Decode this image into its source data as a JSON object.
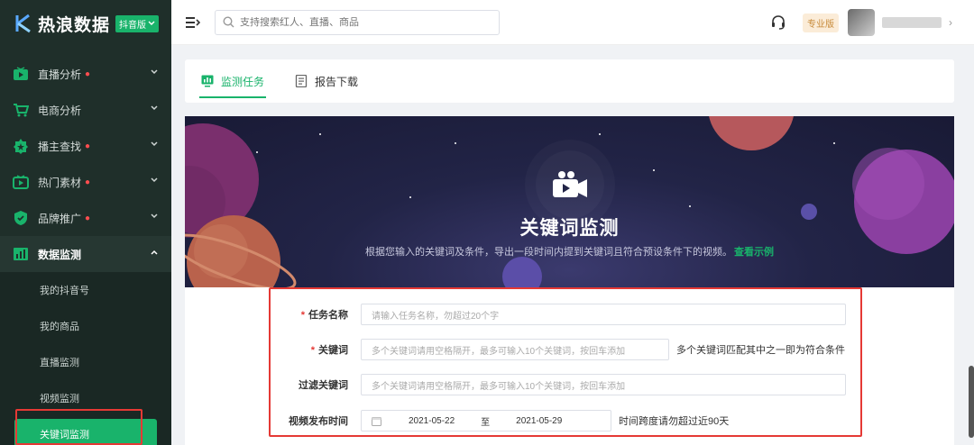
{
  "app": {
    "logo_text": "热浪数据",
    "edition": "抖音版"
  },
  "sidebar": {
    "items": [
      {
        "label": "直播分析",
        "dot": "●"
      },
      {
        "label": "电商分析",
        "dot": ""
      },
      {
        "label": "播主查找",
        "dot": "●"
      },
      {
        "label": "热门素材",
        "dot": "●"
      },
      {
        "label": "品牌推广",
        "dot": "●"
      },
      {
        "label": "数据监测",
        "dot": ""
      }
    ],
    "sub_items": [
      "我的抖音号",
      "我的商品",
      "直播监测",
      "视频监测",
      "关键词监测"
    ]
  },
  "header": {
    "search_placeholder": "支持搜索红人、直播、商品",
    "plan_badge": "专业版"
  },
  "tabs": [
    {
      "label": "监测任务"
    },
    {
      "label": "报告下载"
    }
  ],
  "banner": {
    "title": "关键词监测",
    "description": "根据您输入的关键词及条件，导出一段时间内提到关键词且符合预设条件下的视频。",
    "link": "查看示例"
  },
  "form": {
    "task_name": {
      "label": "任务名称",
      "required": "*",
      "placeholder": "请输入任务名称，勿超过20个字"
    },
    "keywords": {
      "label": "关键词",
      "required": "*",
      "placeholder": "多个关键词请用空格隔开，最多可输入10个关键词，按回车添加",
      "hint": "多个关键词匹配其中之一即为符合条件"
    },
    "filter_keywords": {
      "label": "过滤关键词",
      "placeholder": "多个关键词请用空格隔开，最多可输入10个关键词，按回车添加"
    },
    "publish_time": {
      "label": "视频发布时间",
      "start": "2021-05-22",
      "separator": "至",
      "end": "2021-05-29",
      "hint": "时间跨度请勿超过近90天"
    }
  },
  "colors": {
    "accent": "#19b36b",
    "sidebar_bg": "#1f2f2a",
    "highlight": "#e53935"
  }
}
